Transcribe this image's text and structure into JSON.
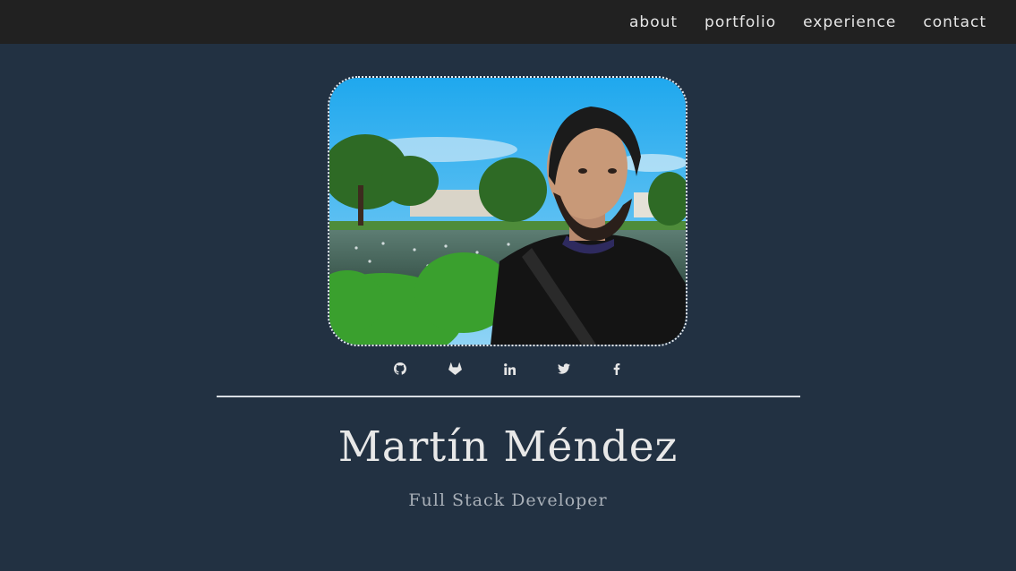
{
  "nav": {
    "links": [
      "about",
      "portfolio",
      "experience",
      "contact"
    ]
  },
  "profile": {
    "name": "Martín Méndez",
    "title": "Full Stack Developer",
    "photo_icon": "profile-photo"
  },
  "socials": [
    {
      "name": "github-icon"
    },
    {
      "name": "gitlab-icon"
    },
    {
      "name": "linkedin-icon"
    },
    {
      "name": "twitter-icon"
    },
    {
      "name": "facebook-icon"
    }
  ],
  "colors": {
    "background": "#223142",
    "navbar": "#212121",
    "text": "#e8e8e8",
    "subtitle": "#a9b0b8"
  }
}
